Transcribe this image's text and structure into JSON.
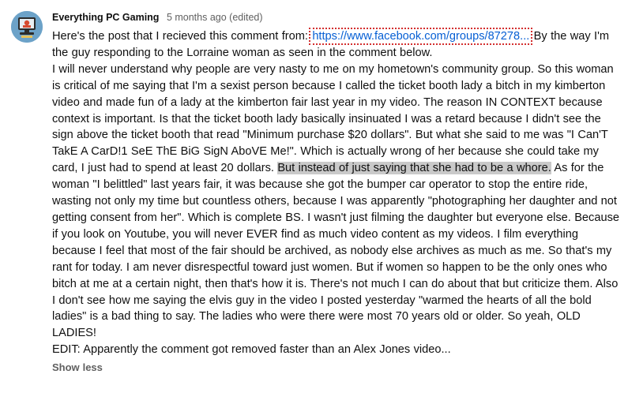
{
  "comment": {
    "author": "Everything PC Gaming",
    "meta": "5 months ago (edited)",
    "para1_before": "Here's the post that I recieved this comment from: ",
    "link_text": "https://www.facebook.com/groups/87278...",
    "para1_after": " By the way I'm the guy responding to the Lorraine woman as seen in the comment below.",
    "para2_before": "I will never understand why people are very nasty to me on my hometown's community group. So this woman is critical of me saying that I'm a sexist person because I called the ticket booth lady a bitch in my kimberton video and made fun of a lady at the kimberton fair last year in my video. The reason IN CONTEXT because context is important. Is that the ticket booth lady basically insinuated I was a retard because I didn't see the sign above the ticket booth that read \"Minimum purchase $20 dollars\". But what she said to me was \"I Can'T TakE A CarD!1 SeE ThE BiG SigN AboVE Me!\". Which is actually wrong of her because she could take my card, I just had to spend at least 20 dollars. ",
    "highlight": "But instead of just saying that she had to be a whore.",
    "para2_after": " As for the woman \"I belittled\" last years fair, it was because she got the bumper car operator to stop the entire ride, wasting not only my time but countless others, because I was apparently \"photographing her daughter and not getting consent from her\". Which is complete BS. I wasn't just filming the daughter but everyone else. Because if you look on Youtube, you will never EVER find as much video content as my videos. I film everything because I feel that most of the fair should be archived, as nobody else archives as much as me. So that's my rant for today. I am never disrespectful toward just women. But if women so happen to be the only ones who bitch at me at a certain night, then that's how it is. There's not much I can do about that but criticize them. Also I don't see how me saying the elvis guy in the video I posted yesterday \"warmed the hearts of all the bold ladies\" is a bad thing to say. The ladies who were there were most 70 years old or older. So yeah, OLD LADIES!",
    "edit_note": "EDIT: Apparently the comment got removed faster than an Alex Jones video...",
    "show_less": "Show less"
  },
  "icons": {
    "avatar": "channel-avatar"
  }
}
